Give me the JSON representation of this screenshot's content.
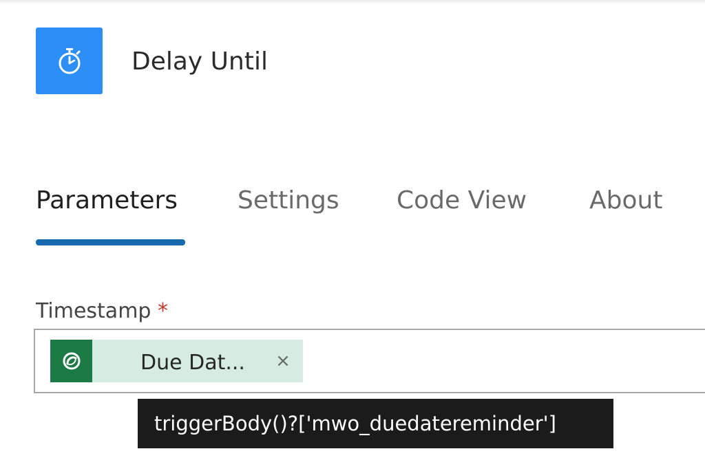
{
  "action": {
    "title": "Delay Until",
    "icon": "stopwatch-icon",
    "icon_color": "#2d8ef7"
  },
  "tabs": [
    {
      "label": "Parameters",
      "active": true
    },
    {
      "label": "Settings",
      "active": false
    },
    {
      "label": "Code View",
      "active": false
    },
    {
      "label": "About",
      "active": false
    }
  ],
  "accent_color": "#1a6ab0",
  "field": {
    "label": "Timestamp",
    "required_marker": "*",
    "token": {
      "label": "Due Dat...",
      "icon": "dataverse-icon",
      "icon_color": "#1c7a45",
      "remove_glyph": "×"
    }
  },
  "tooltip": {
    "text": "triggerBody()?['mwo_duedatereminder']"
  }
}
